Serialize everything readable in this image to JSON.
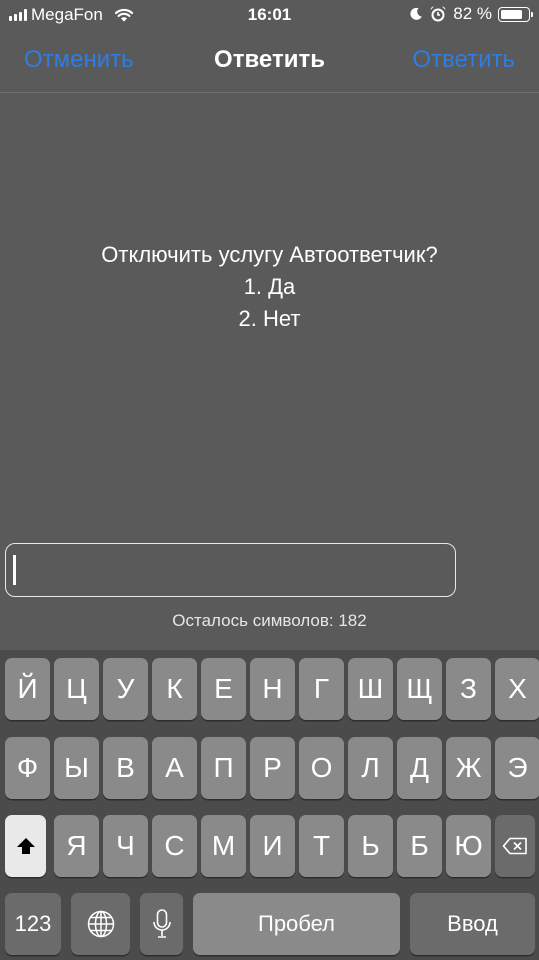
{
  "status_bar": {
    "carrier": "MegaFon",
    "time": "16:01",
    "battery_text": "82 %",
    "battery_level": 0.82
  },
  "nav": {
    "cancel_label": "Отменить",
    "title": "Ответить",
    "reply_label": "Ответить"
  },
  "message": {
    "question": "Отключить услугу Автоответчик?",
    "option_1": "1. Да",
    "option_2": "2. Нет"
  },
  "reply_input": {
    "value": ""
  },
  "counter": {
    "text": "Осталось символов: 182"
  },
  "keyboard": {
    "row1": [
      "Й",
      "Ц",
      "У",
      "К",
      "Е",
      "Н",
      "Г",
      "Ш",
      "Щ",
      "З",
      "Х"
    ],
    "row2": [
      "Ф",
      "Ы",
      "В",
      "А",
      "П",
      "Р",
      "О",
      "Л",
      "Д",
      "Ж",
      "Э"
    ],
    "row3": [
      "Я",
      "Ч",
      "С",
      "М",
      "И",
      "Т",
      "Ь",
      "Б",
      "Ю"
    ],
    "numbers_label": "123",
    "space_label": "Пробел",
    "return_label": "Ввод",
    "shift_icon": "shift-arrow-icon",
    "globe_icon": "globe-icon",
    "mic_icon": "microphone-icon",
    "delete_icon": "backspace-icon"
  },
  "colors": {
    "accent": "#2f7de1",
    "background": "#5a5a5a",
    "keyboard_bg": "#4b4b4b",
    "key": "#8a8a8a",
    "key_dark": "#6b6b6b"
  }
}
